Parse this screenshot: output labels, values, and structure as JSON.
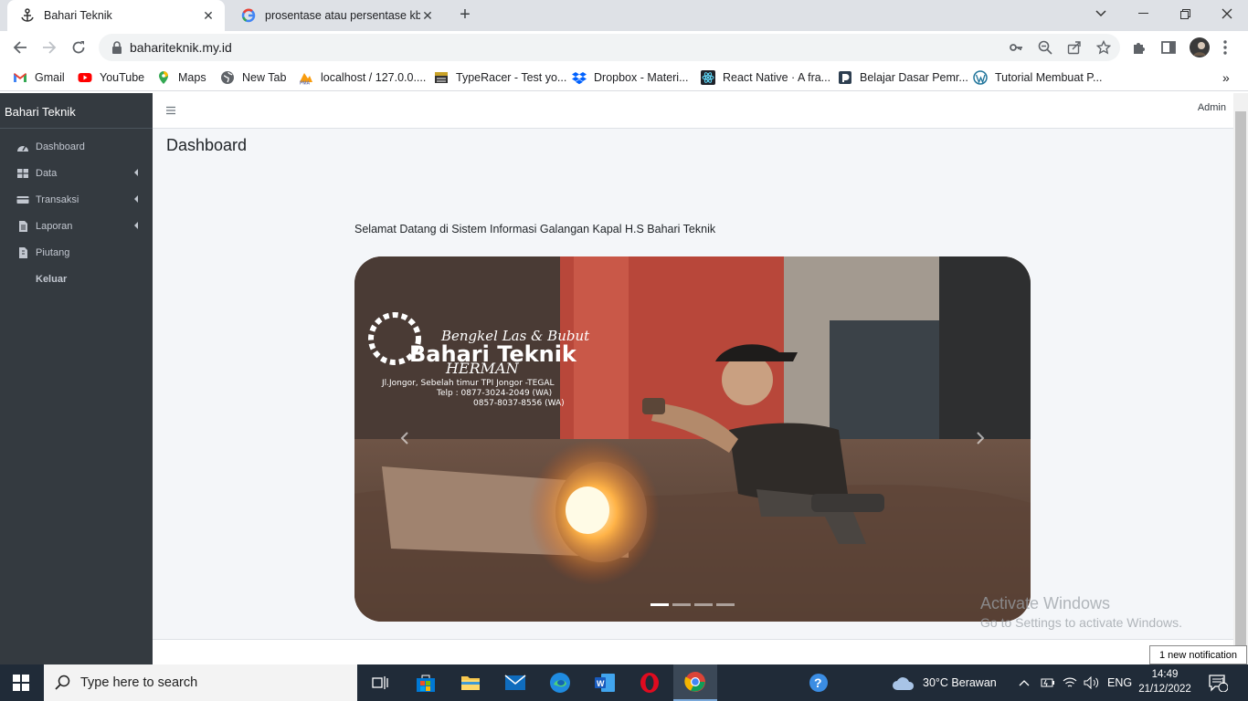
{
  "browser": {
    "tabs": [
      {
        "title": "Bahari Teknik",
        "active": true
      },
      {
        "title": "prosentase atau persentase kbbi",
        "active": false
      }
    ],
    "url": "bahariteknik.my.id",
    "bookmarks": [
      {
        "label": "Gmail",
        "icon": "gmail-icon"
      },
      {
        "label": "YouTube",
        "icon": "youtube-icon"
      },
      {
        "label": "Maps",
        "icon": "maps-icon"
      },
      {
        "label": "New Tab",
        "icon": "globe-icon"
      },
      {
        "label": "localhost / 127.0.0....",
        "icon": "phpmyadmin-icon"
      },
      {
        "label": "TypeRacer - Test yo...",
        "icon": "typeracer-icon"
      },
      {
        "label": "Dropbox - Materi...",
        "icon": "dropbox-icon"
      },
      {
        "label": "React Native · A fra...",
        "icon": "react-icon"
      },
      {
        "label": "Belajar Dasar Pemr...",
        "icon": "dicoding-icon"
      },
      {
        "label": "Tutorial Membuat P...",
        "icon": "wordpress-icon"
      }
    ],
    "more_bookmarks": "»"
  },
  "app": {
    "brand": "Bahari Teknik",
    "menu": [
      {
        "label": "Dashboard",
        "icon": "dashboard-icon",
        "has_arrow": false
      },
      {
        "label": "Data",
        "icon": "table-icon",
        "has_arrow": true
      },
      {
        "label": "Transaksi",
        "icon": "card-icon",
        "has_arrow": true
      },
      {
        "label": "Laporan",
        "icon": "document-icon",
        "has_arrow": true
      },
      {
        "label": "Piutang",
        "icon": "file-icon",
        "has_arrow": false
      },
      {
        "label": "Keluar",
        "icon": "",
        "has_arrow": false
      }
    ],
    "user": "Admin",
    "page_title": "Dashboard",
    "welcome": "Selamat Datang di Sistem Informasi Galangan Kapal H.S Bahari Teknik",
    "carousel": {
      "logo_script": "Bengkel Las & Bubut",
      "logo_name": "Bahari Teknik",
      "logo_owner": "HERMAN",
      "address": "Jl.Jongor, Sebelah timur TPI Jongor -TEGAL",
      "phone1": "Telp : 0877-3024-2049 (WA)",
      "phone2": "0857-8037-8556 (WA)",
      "slides": 4,
      "active_slide": 1
    }
  },
  "windows": {
    "activate_title": "Activate Windows",
    "activate_sub": "Go to Settings to activate Windows.",
    "notification": "1 new notification",
    "search_placeholder": "Type here to search",
    "weather": "30°C  Berawan",
    "lang": "ENG",
    "time": "14:49",
    "date": "21/12/2022",
    "notif_count": "1"
  },
  "colors": {
    "sidebar": "#343a40",
    "content_bg": "#f4f6f9",
    "taskbar": "#202b38"
  }
}
